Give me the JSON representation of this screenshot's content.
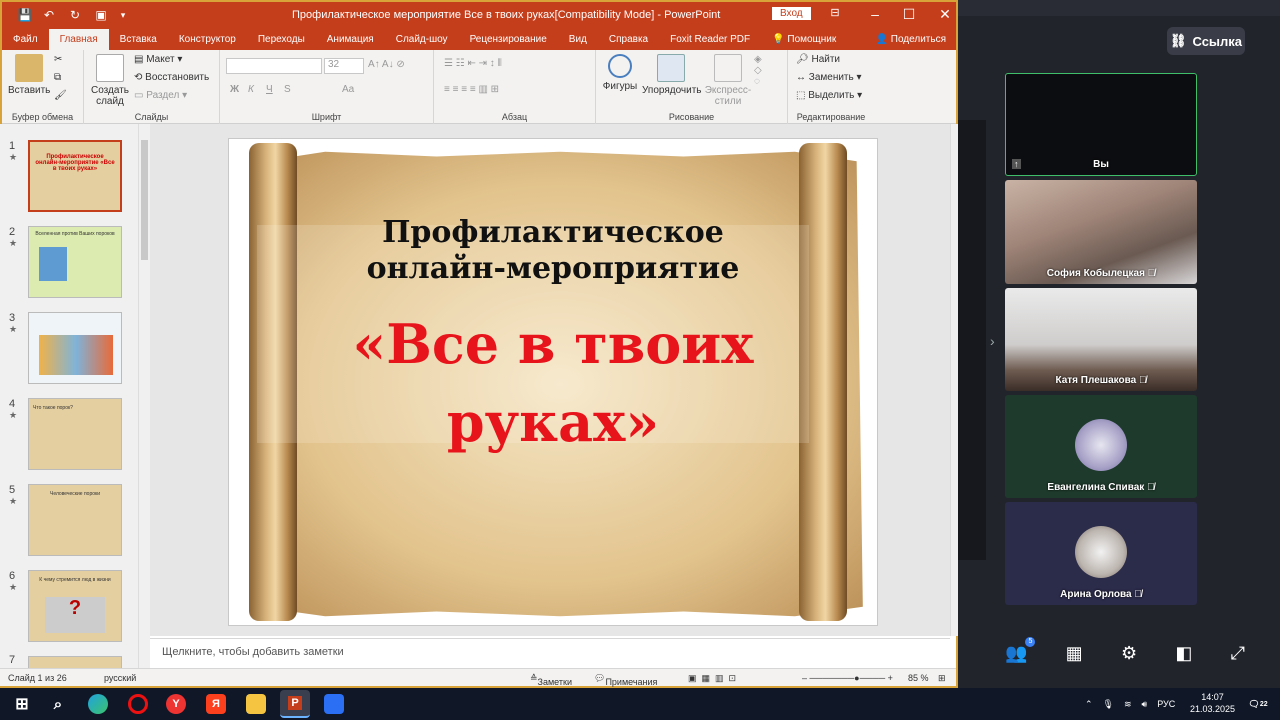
{
  "window": {
    "title": "Профилактическое мероприятие Все в твоих руках[Compatibility Mode]  -  PowerPoint",
    "login_button": "Вход"
  },
  "menu": {
    "tabs": [
      "Файл",
      "Главная",
      "Вставка",
      "Конструктор",
      "Переходы",
      "Анимация",
      "Слайд-шоу",
      "Рецензирование",
      "Вид",
      "Справка",
      "Foxit Reader PDF"
    ],
    "help_search": "Помощник",
    "share": "Поделиться"
  },
  "ribbon": {
    "clipboard": {
      "paste": "Вставить",
      "group": "Буфер обмена"
    },
    "slides": {
      "new_slide_1": "Создать",
      "new_slide_2": "слайд",
      "layout": "Макет",
      "reset": "Восстановить",
      "section": "Раздел",
      "group": "Слайды"
    },
    "font": {
      "size": "32",
      "bold": "Ж",
      "italic": "К",
      "underline": "Ч",
      "strike": "S",
      "case": "Aa",
      "group": "Шрифт"
    },
    "paragraph": {
      "group": "Абзац"
    },
    "drawing": {
      "shapes": "Фигуры",
      "arrange": "Упорядочить",
      "quick_styles_1": "Экспресс-",
      "quick_styles_2": "стили",
      "group": "Рисование"
    },
    "editing": {
      "find": "Найти",
      "replace": "Заменить",
      "select": "Выделить",
      "group": "Редактирование"
    }
  },
  "thumbnails": [
    {
      "num": "1",
      "text": "Профилактическое онлайн-мероприятие «Все в твоих руках»"
    },
    {
      "num": "2",
      "text": "Вселенная против Ваших пороков"
    },
    {
      "num": "3",
      "text": ""
    },
    {
      "num": "4",
      "text": "Что такое порок?"
    },
    {
      "num": "5",
      "text": "Человеческие пороки"
    },
    {
      "num": "6",
      "text": "К чему стремится люд в жизни"
    },
    {
      "num": "7",
      "text": ""
    }
  ],
  "slide": {
    "line1": "Профилактическое",
    "line2": "онлайн-мероприятие",
    "line3": "«Все в твоих",
    "line4": "руках»"
  },
  "notes_placeholder": "Щелкните, чтобы добавить заметки",
  "status": {
    "slide_count": "Слайд 1 из 26",
    "language": "русский",
    "notes": "Заметки",
    "comments": "Примечания",
    "zoom": "85 %"
  },
  "meeting": {
    "link_button": "Ссылка",
    "participants": [
      {
        "name": "Вы"
      },
      {
        "name": "София Кобылецкая"
      },
      {
        "name": "Катя Плешакова"
      },
      {
        "name": "Евангелина Спивак"
      },
      {
        "name": "Арина Орлова"
      }
    ],
    "participant_badge": "5"
  },
  "taskbar": {
    "language": "РУС",
    "time": "14:07",
    "date": "21.03.2025",
    "notification_count": "22"
  }
}
